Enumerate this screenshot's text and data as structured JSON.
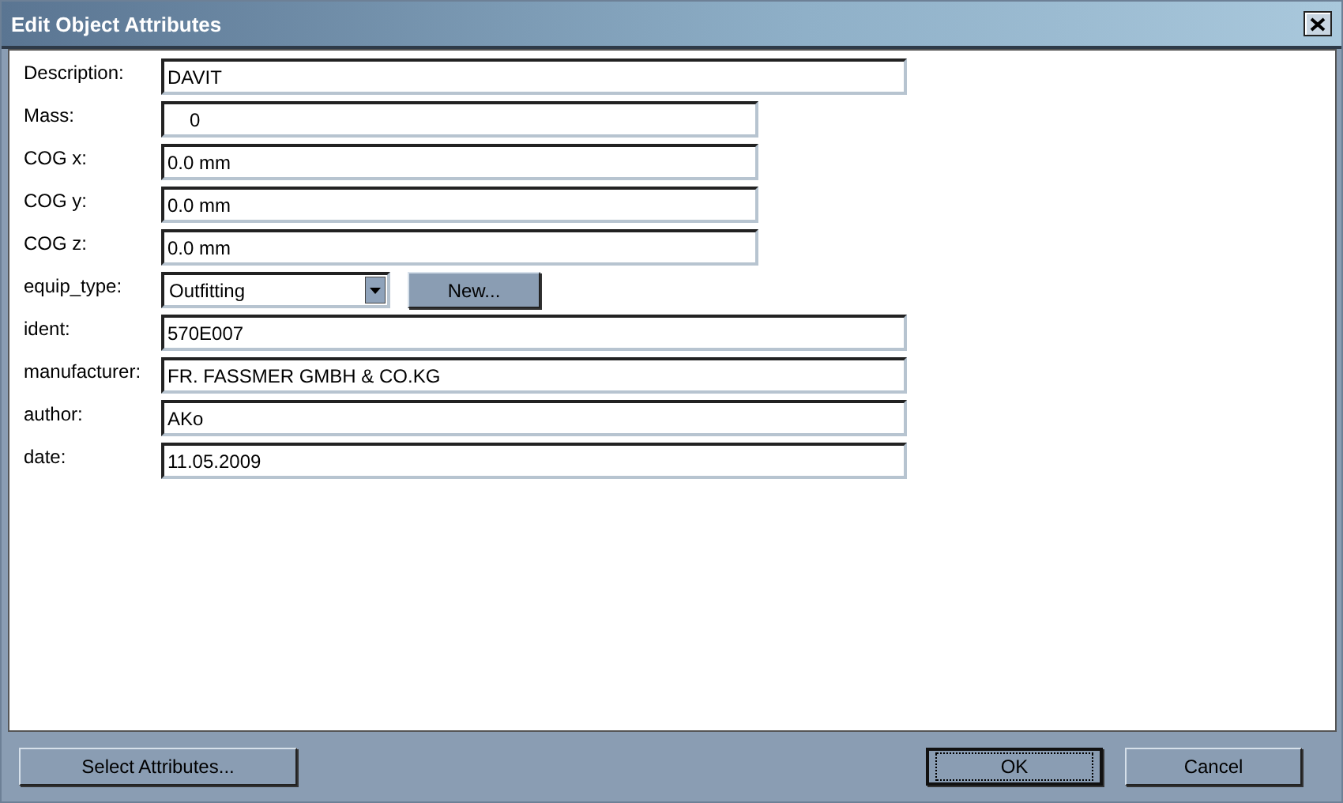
{
  "window": {
    "title": "Edit Object Attributes"
  },
  "fields": [
    {
      "label": "Description:",
      "kind": "text",
      "value": "DAVIT"
    },
    {
      "label": "Mass:",
      "kind": "measure",
      "value": "0"
    },
    {
      "label": "COG x:",
      "kind": "measure",
      "value": "0.0 mm"
    },
    {
      "label": "COG y:",
      "kind": "measure",
      "value": "0.0 mm"
    },
    {
      "label": "COG z:",
      "kind": "measure",
      "value": "0.0 mm"
    },
    {
      "label": "equip_type:",
      "kind": "dropdown",
      "value": "Outfitting",
      "button": "New..."
    },
    {
      "label": "ident:",
      "kind": "text",
      "value": "570E007"
    },
    {
      "label": "manufacturer:",
      "kind": "text",
      "value": "FR. FASSMER GMBH & CO.KG"
    },
    {
      "label": "author:",
      "kind": "text",
      "value": "AKo"
    },
    {
      "label": "date:",
      "kind": "text",
      "value": "11.05.2009"
    }
  ],
  "buttons": [
    {
      "label": "Select Attributes...",
      "focused": false
    },
    {
      "label": "OK",
      "focused": true
    },
    {
      "label": "Cancel",
      "focused": false
    }
  ]
}
